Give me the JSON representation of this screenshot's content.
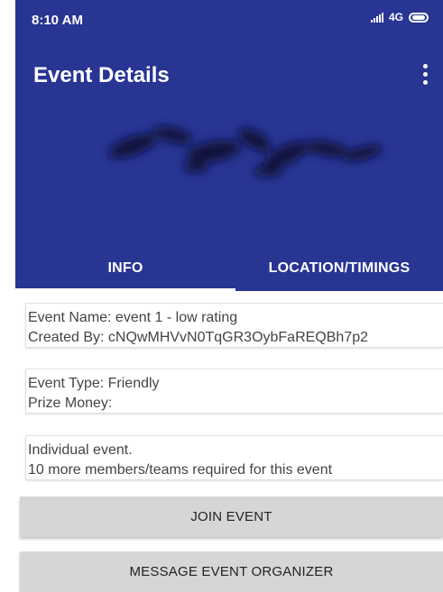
{
  "status_bar": {
    "time": "8:10 AM",
    "network": "4G",
    "icons": [
      "signal-icon",
      "battery-icon"
    ]
  },
  "toolbar": {
    "title": "Event Details",
    "menu_icon": "more-vert-icon"
  },
  "colors": {
    "primary": "#283593",
    "button_bg": "#d6d6d6",
    "text": "#444444"
  },
  "tabs": [
    {
      "label": "INFO",
      "selected": true
    },
    {
      "label": "LOCATION/TIMINGS",
      "selected": false
    }
  ],
  "cards": [
    {
      "lines": [
        "Event Name: event 1 - low rating",
        "Created By: cNQwMHVvN0TqGR3OybFaREQBh7p2"
      ]
    },
    {
      "lines": [
        "Event Type: Friendly",
        "Prize Money:"
      ]
    },
    {
      "lines": [
        "Individual event.",
        "10 more members/teams required for this event"
      ]
    }
  ],
  "buttons": {
    "join": "JOIN EVENT",
    "message": "MESSAGE EVENT ORGANIZER"
  }
}
